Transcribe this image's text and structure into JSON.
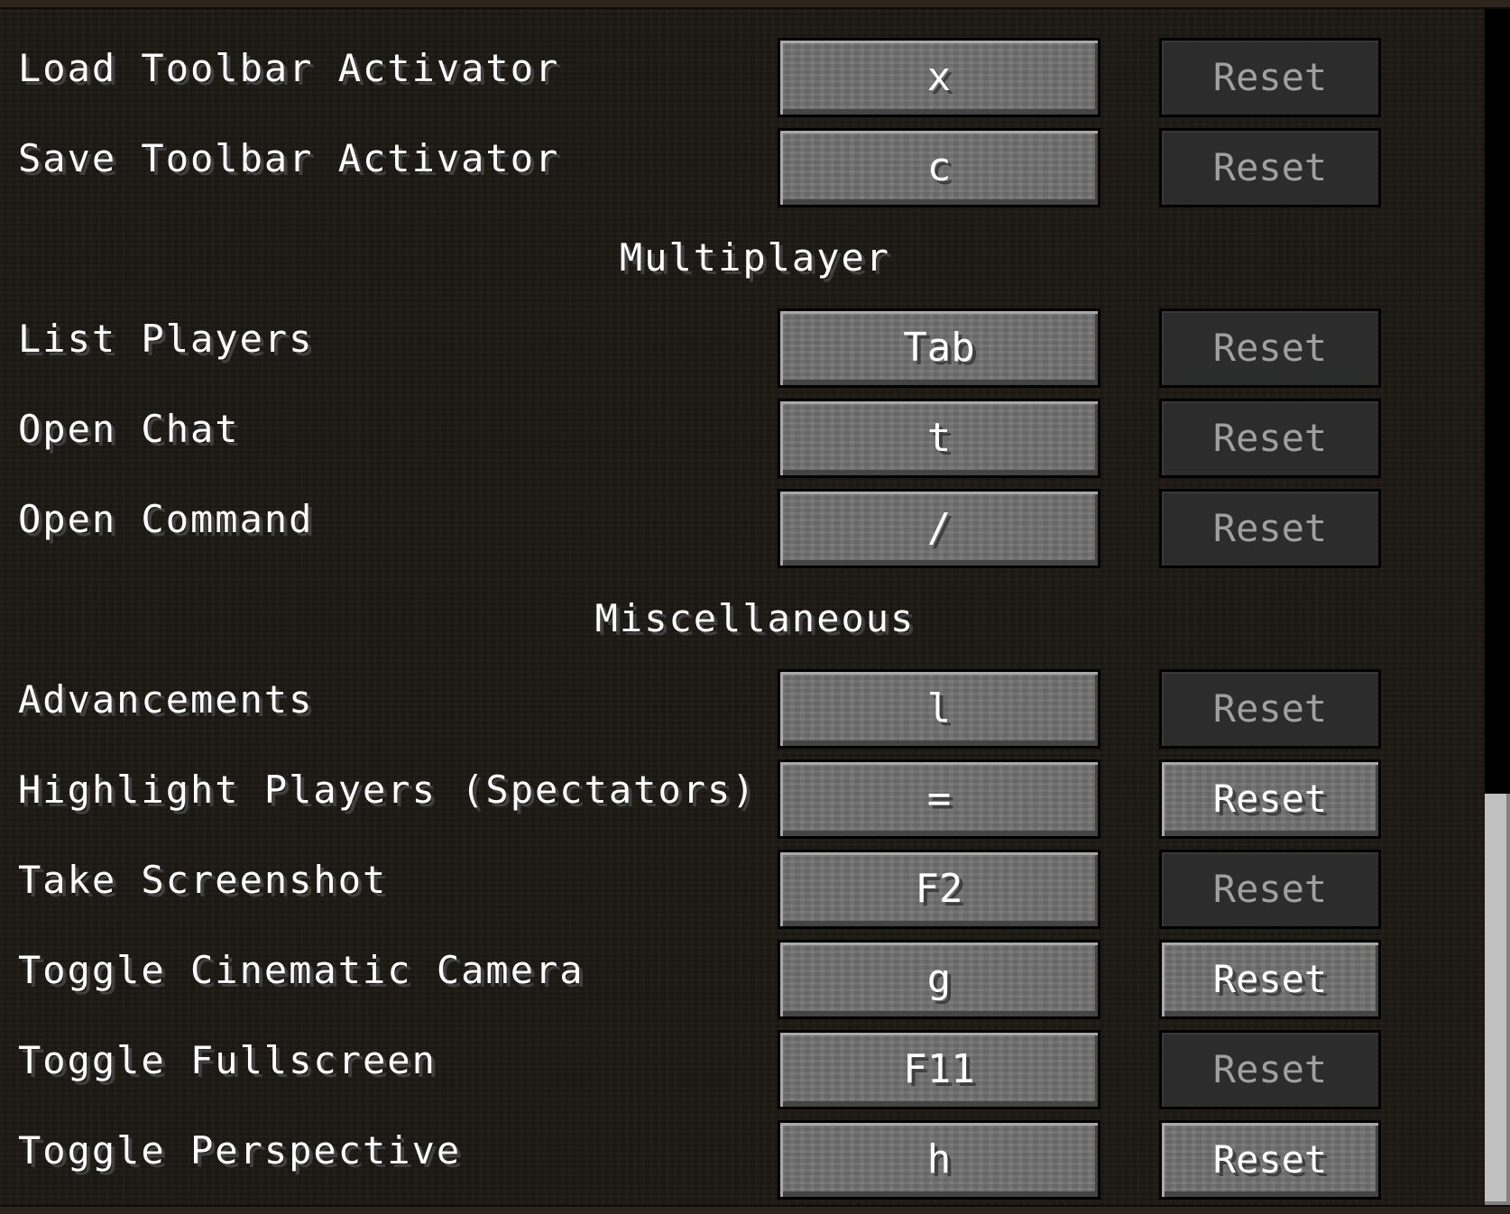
{
  "controls": {
    "reset_label": "Reset",
    "rows": [
      {
        "label": "Load Toolbar Activator",
        "key": "x",
        "reset_enabled": false
      },
      {
        "label": "Save Toolbar Activator",
        "key": "c",
        "reset_enabled": false
      },
      {
        "label": "List Players",
        "key": "Tab",
        "reset_enabled": false
      },
      {
        "label": "Open Chat",
        "key": "t",
        "reset_enabled": false
      },
      {
        "label": "Open Command",
        "key": "/",
        "reset_enabled": false
      },
      {
        "label": "Advancements",
        "key": "l",
        "reset_enabled": false
      },
      {
        "label": "Highlight Players (Spectators)",
        "key": "=",
        "reset_enabled": true
      },
      {
        "label": "Take Screenshot",
        "key": "F2",
        "reset_enabled": false
      },
      {
        "label": "Toggle Cinematic Camera",
        "key": "g",
        "reset_enabled": true
      },
      {
        "label": "Toggle Fullscreen",
        "key": "F11",
        "reset_enabled": false
      },
      {
        "label": "Toggle Perspective",
        "key": "h",
        "reset_enabled": true
      }
    ],
    "sections": [
      {
        "title": "Multiplayer"
      },
      {
        "title": "Miscellaneous"
      }
    ]
  },
  "scrollbar": {
    "scroll_fraction": 0.66
  }
}
